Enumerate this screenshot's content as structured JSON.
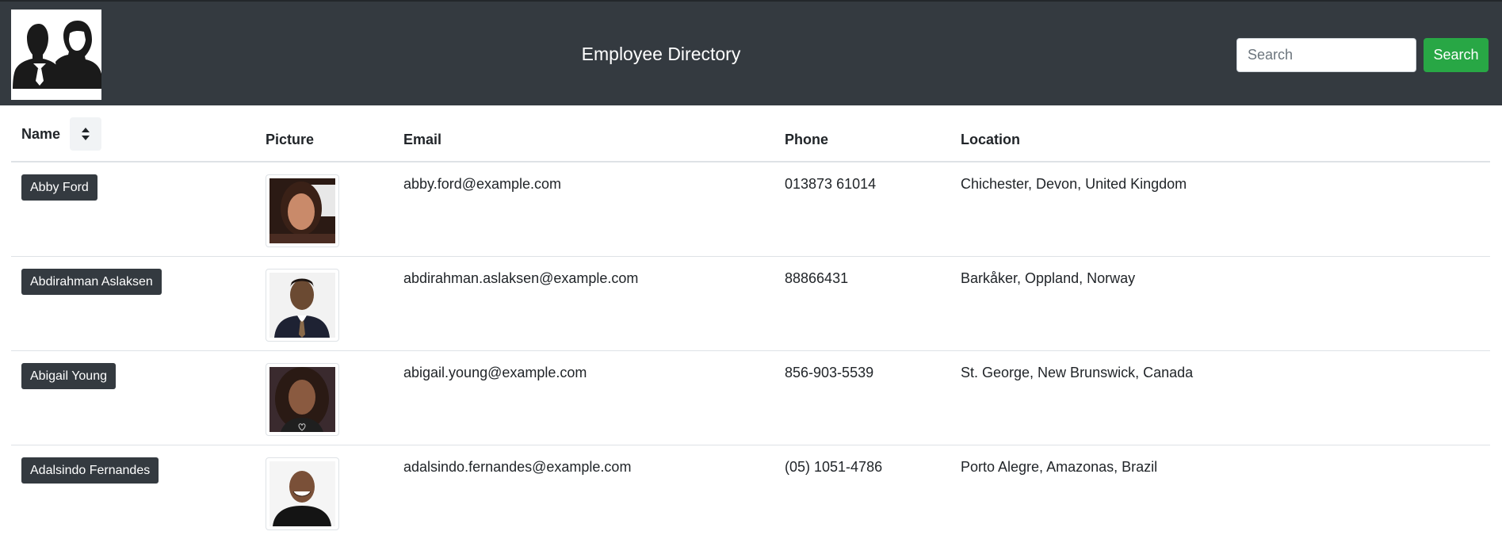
{
  "header": {
    "logo_icon": "employees-logo-icon",
    "title": "Employee Directory",
    "search_placeholder": "Search",
    "search_button_label": "Search",
    "accent_color": "#28a745",
    "bar_color": "#343a40"
  },
  "table": {
    "columns": {
      "name": "Name",
      "picture": "Picture",
      "email": "Email",
      "phone": "Phone",
      "location": "Location"
    },
    "sort_icon": "sort-icon",
    "rows": [
      {
        "name": "Abby Ford",
        "email": "abby.ford@example.com",
        "phone": "013873 61014",
        "location": "Chichester, Devon, United Kingdom",
        "photo_icon": "person-photo"
      },
      {
        "name": "Abdirahman Aslaksen",
        "email": "abdirahman.aslaksen@example.com",
        "phone": "88866431",
        "location": "Barkåker, Oppland, Norway",
        "photo_icon": "person-photo"
      },
      {
        "name": "Abigail Young",
        "email": "abigail.young@example.com",
        "phone": "856-903-5539",
        "location": "St. George, New Brunswick, Canada",
        "photo_icon": "person-photo"
      },
      {
        "name": "Adalsindo Fernandes",
        "email": "adalsindo.fernandes@example.com",
        "phone": "(05) 1051-4786",
        "location": "Porto Alegre, Amazonas, Brazil",
        "photo_icon": "person-photo"
      }
    ]
  }
}
